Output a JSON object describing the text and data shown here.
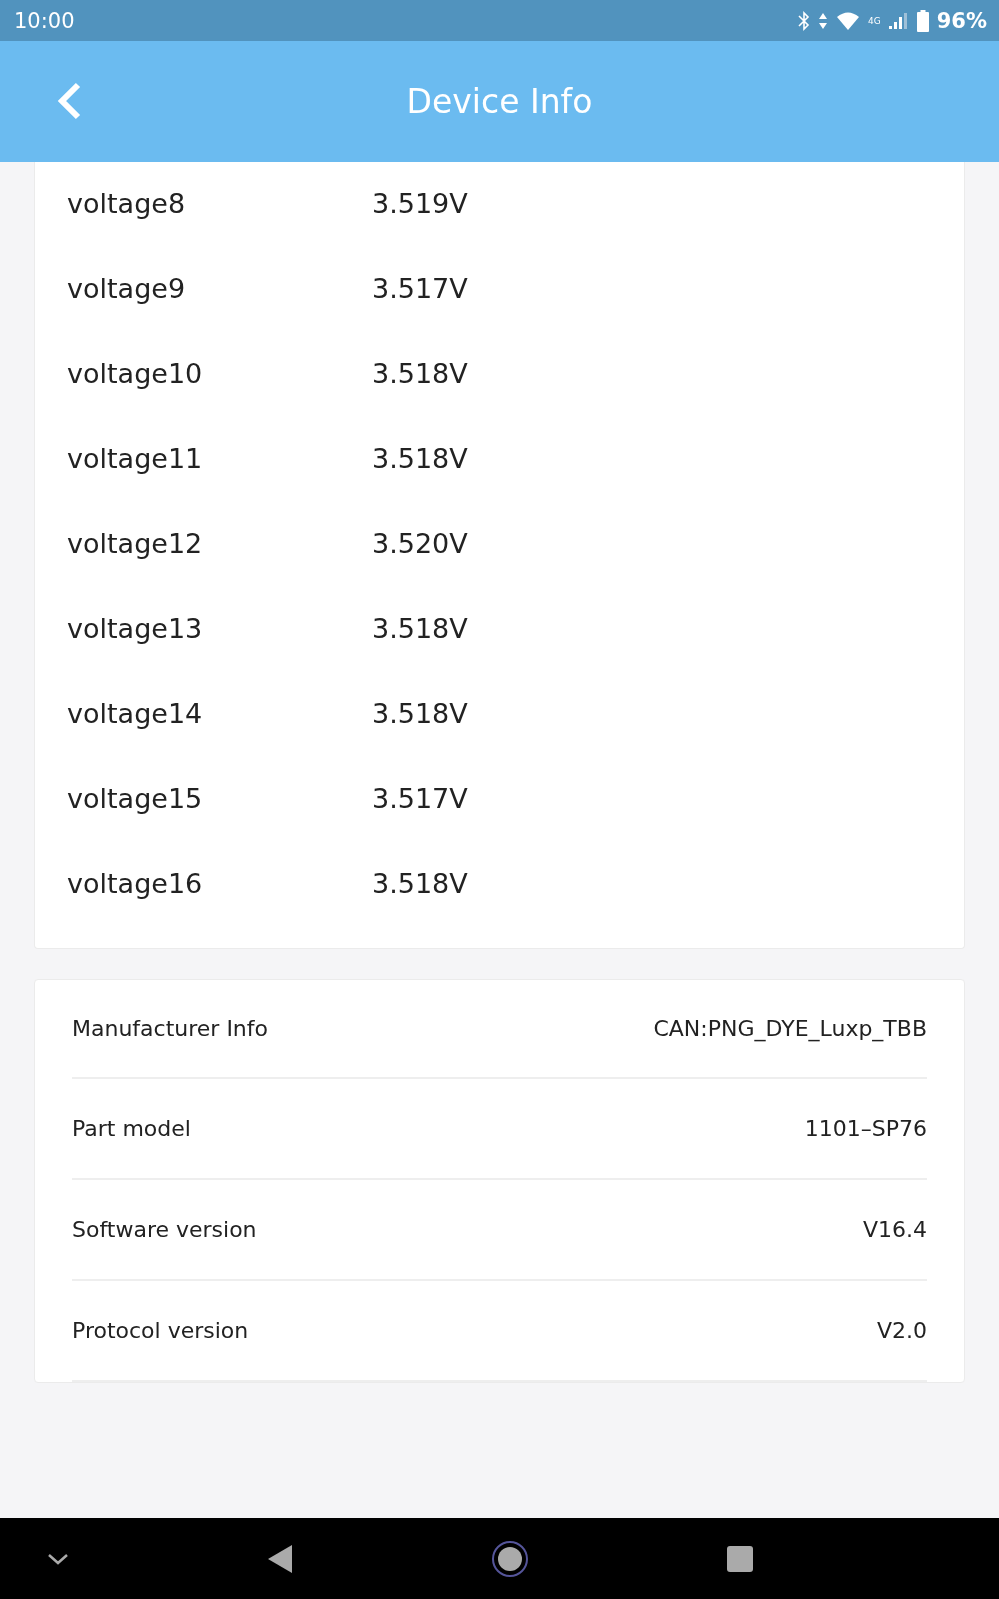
{
  "status_bar": {
    "time": "10:00",
    "network": "4G",
    "battery": "96%"
  },
  "header": {
    "title": "Device Info"
  },
  "voltages": [
    {
      "name": "voltage8",
      "value": "3.519V"
    },
    {
      "name": "voltage9",
      "value": "3.517V"
    },
    {
      "name": "voltage10",
      "value": "3.518V"
    },
    {
      "name": "voltage11",
      "value": "3.518V"
    },
    {
      "name": "voltage12",
      "value": "3.520V"
    },
    {
      "name": "voltage13",
      "value": "3.518V"
    },
    {
      "name": "voltage14",
      "value": "3.518V"
    },
    {
      "name": "voltage15",
      "value": "3.517V"
    },
    {
      "name": "voltage16",
      "value": "3.518V"
    }
  ],
  "info": [
    {
      "label": "Manufacturer Info",
      "value": "CAN:PNG_DYE_Luxp_TBB"
    },
    {
      "label": "Part model",
      "value": "1101–SP76"
    },
    {
      "label": "Software version",
      "value": "V16.4"
    },
    {
      "label": "Protocol version",
      "value": "V2.0"
    }
  ]
}
